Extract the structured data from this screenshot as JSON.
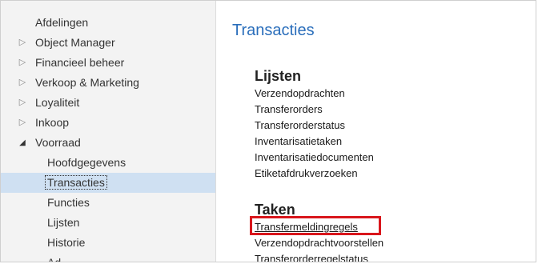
{
  "sidebar": {
    "items": [
      {
        "label": "Afdelingen",
        "toggle": ""
      },
      {
        "label": "Object Manager",
        "toggle": "▷"
      },
      {
        "label": "Financieel beheer",
        "toggle": "▷"
      },
      {
        "label": "Verkoop & Marketing",
        "toggle": "▷"
      },
      {
        "label": "Loyaliteit",
        "toggle": "▷"
      },
      {
        "label": "Inkoop",
        "toggle": "▷"
      },
      {
        "label": "Voorraad",
        "toggle": "◢"
      }
    ],
    "subitems": [
      {
        "label": "Hoofdgegevens"
      },
      {
        "label": "Transacties",
        "selected": true
      },
      {
        "label": "Functies"
      },
      {
        "label": "Lijsten"
      },
      {
        "label": "Historie"
      },
      {
        "label": "Ad..."
      }
    ]
  },
  "main": {
    "title": "Transacties",
    "sections": [
      {
        "title": "Lijsten",
        "links": [
          "Verzendopdrachten",
          "Transferorders",
          "Transferorderstatus",
          "Inventarisatietaken",
          "Inventarisatiedocumenten",
          "Etiketafdrukverzoeken"
        ]
      },
      {
        "title": "Taken",
        "links": [
          "Transfermeldingregels",
          "Verzendopdrachtvoorstellen",
          "Transferorderregelstatus"
        ]
      }
    ],
    "highlight_color": "#d9161c",
    "title_color": "#2a6ebb"
  }
}
